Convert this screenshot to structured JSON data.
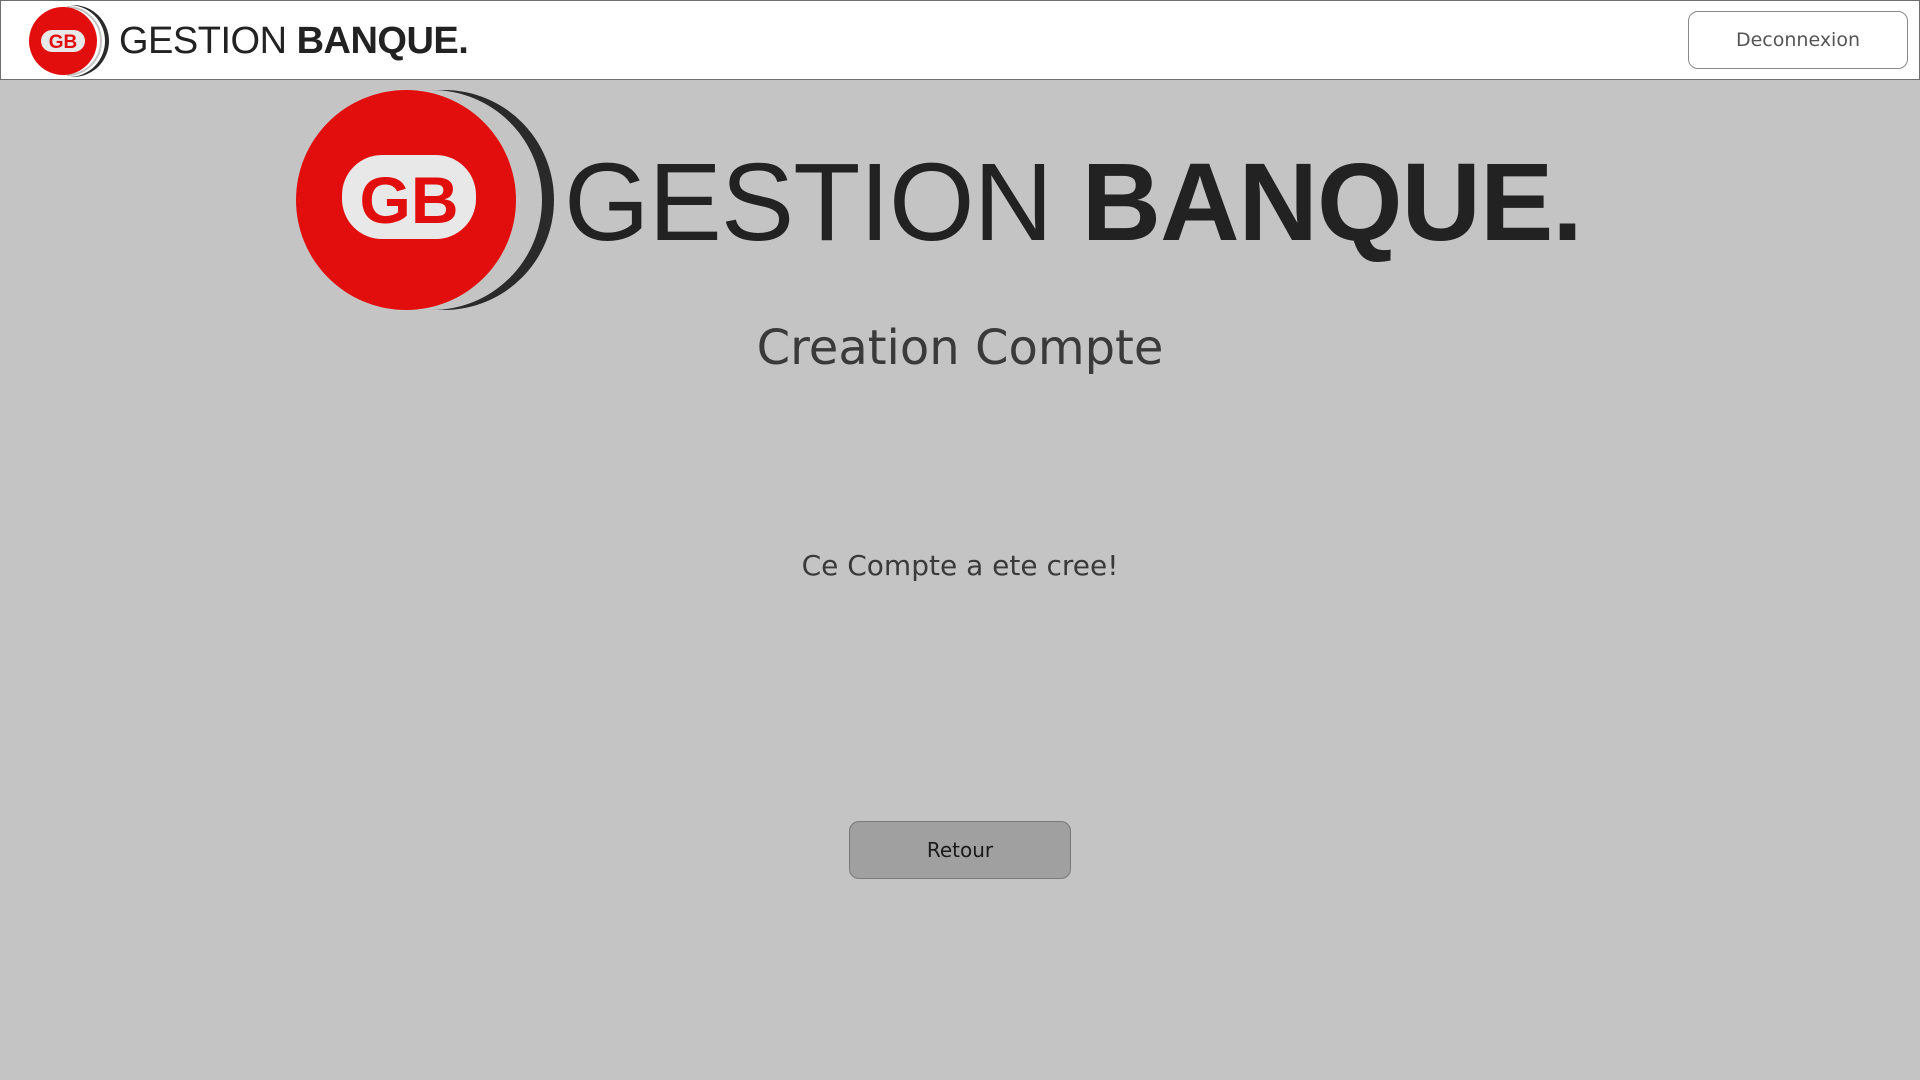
{
  "header": {
    "logo_mark": "GB",
    "brand_light": "GESTION ",
    "brand_bold": "BANQUE.",
    "logout_label": "Deconnexion"
  },
  "hero": {
    "logo_mark": "GB",
    "brand_light": "GESTION ",
    "brand_bold": "BANQUE."
  },
  "main": {
    "title": "Creation Compte",
    "message": "Ce Compte a ete cree!",
    "back_label": "Retour"
  },
  "colors": {
    "background": "#c4c4c4",
    "header_background": "#ffffff",
    "brand_red": "#e20e0e",
    "brand_dark": "#222222",
    "button_gray": "#a0a0a0"
  }
}
